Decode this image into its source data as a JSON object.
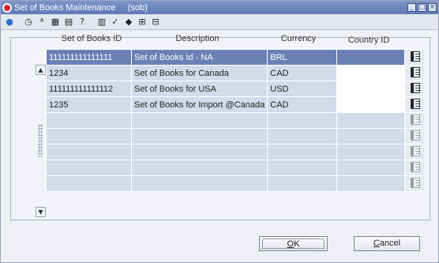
{
  "window": {
    "title": "Set of Books Maintenance     (sob)",
    "controls": [
      "minimize",
      "maximize",
      "close"
    ]
  },
  "toolbar": {
    "icons": [
      "globe-icon",
      "clock-icon",
      "spellcheck-icon",
      "calendar-icon",
      "print-icon",
      "help-icon",
      "grid-icon",
      "check-icon",
      "folder-icon",
      "tree-icon",
      "tree2-icon"
    ]
  },
  "columns": {
    "sob_id": "Set of Books ID",
    "description": "Description",
    "currency": "Currency",
    "country": "Country ID"
  },
  "rows": [
    {
      "sob_id": "111111111111111",
      "description": "Set of Books Id - NA",
      "currency": "BRL",
      "country": ""
    },
    {
      "sob_id": "1234",
      "description": "Set of Books for Canada",
      "currency": "CAD",
      "country": ""
    },
    {
      "sob_id": "111111111111112",
      "description": "Set of Books for USA",
      "currency": "USD",
      "country": ""
    },
    {
      "sob_id": "1235",
      "description": "Set of Books for Import @Canada",
      "currency": "CAD",
      "country": ""
    }
  ],
  "buttons": {
    "ok_rest": "K",
    "ok_mnemonic": "O",
    "cancel_mnemonic": "C",
    "cancel_rest": "ancel"
  }
}
